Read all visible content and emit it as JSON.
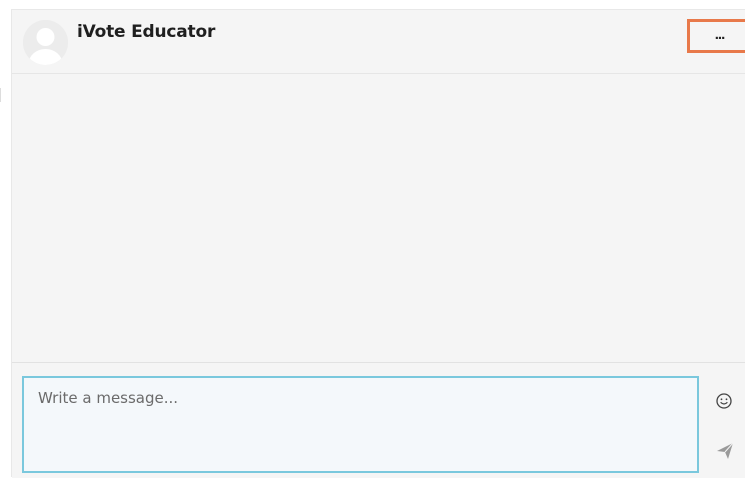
{
  "header": {
    "contact_name": "iVote Educator",
    "more_label": "..."
  },
  "composer": {
    "placeholder": "Write a message..."
  },
  "icons": {
    "avatar": "user-avatar-icon",
    "emoji": "smiley-icon",
    "send": "paper-plane-icon"
  },
  "colors": {
    "highlight": "#e8794a",
    "input_border": "#7ac8dd",
    "panel_bg": "#f5f5f5"
  }
}
